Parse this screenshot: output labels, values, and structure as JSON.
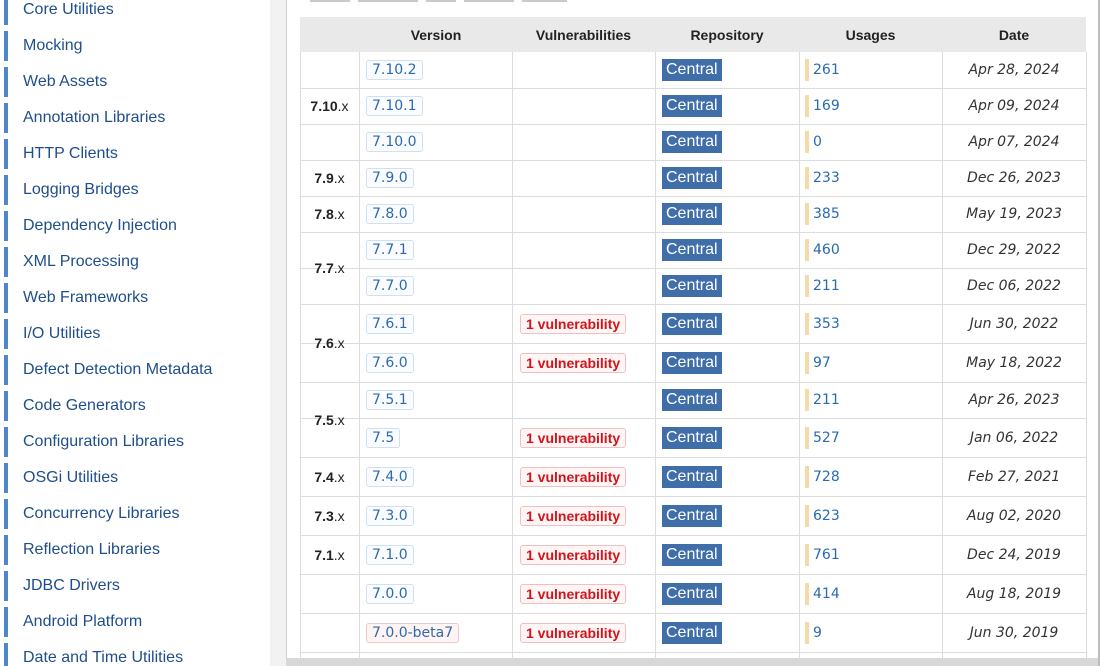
{
  "sidebar": {
    "items": [
      "Core Utilities",
      "Mocking",
      "Web Assets",
      "Annotation Libraries",
      "HTTP Clients",
      "Logging Bridges",
      "Dependency Injection",
      "XML Processing",
      "Web Frameworks",
      "I/O Utilities",
      "Defect Detection Metadata",
      "Code Generators",
      "Configuration Libraries",
      "OSGi Utilities",
      "Concurrency Libraries",
      "Reflection Libraries",
      "JDBC Drivers",
      "Android Platform",
      "Date and Time Utilities"
    ]
  },
  "table": {
    "headers": [
      "Version",
      "Vulnerabilities",
      "Repository",
      "Usages",
      "Date"
    ],
    "rows": [
      {
        "version": "7.10.2",
        "vuln": "",
        "repo": "Central",
        "usages": "261",
        "date": "Apr 28, 2024"
      },
      {
        "version": "7.10.1",
        "vuln": "",
        "repo": "Central",
        "usages": "169",
        "date": "Apr 09, 2024"
      },
      {
        "version": "7.10.0",
        "vuln": "",
        "repo": "Central",
        "usages": "0",
        "date": "Apr 07, 2024"
      },
      {
        "version": "7.9.0",
        "vuln": "",
        "repo": "Central",
        "usages": "233",
        "date": "Dec 26, 2023"
      },
      {
        "version": "7.8.0",
        "vuln": "",
        "repo": "Central",
        "usages": "385",
        "date": "May 19, 2023"
      },
      {
        "version": "7.7.1",
        "vuln": "",
        "repo": "Central",
        "usages": "460",
        "date": "Dec 29, 2022"
      },
      {
        "version": "7.7.0",
        "vuln": "",
        "repo": "Central",
        "usages": "211",
        "date": "Dec 06, 2022"
      },
      {
        "version": "7.6.1",
        "vuln": "1 vulnerability",
        "repo": "Central",
        "usages": "353",
        "date": "Jun 30, 2022"
      },
      {
        "version": "7.6.0",
        "vuln": "1 vulnerability",
        "repo": "Central",
        "usages": "97",
        "date": "May 18, 2022"
      },
      {
        "version": "7.5.1",
        "vuln": "",
        "repo": "Central",
        "usages": "211",
        "date": "Apr 26, 2023"
      },
      {
        "version": "7.5",
        "vuln": "1 vulnerability",
        "repo": "Central",
        "usages": "527",
        "date": "Jan 06, 2022"
      },
      {
        "version": "7.4.0",
        "vuln": "1 vulnerability",
        "repo": "Central",
        "usages": "728",
        "date": "Feb 27, 2021"
      },
      {
        "version": "7.3.0",
        "vuln": "1 vulnerability",
        "repo": "Central",
        "usages": "623",
        "date": "Aug 02, 2020"
      },
      {
        "version": "7.1.0",
        "vuln": "1 vulnerability",
        "repo": "Central",
        "usages": "761",
        "date": "Dec 24, 2019"
      },
      {
        "version": "7.0.0",
        "vuln": "1 vulnerability",
        "repo": "Central",
        "usages": "414",
        "date": "Aug 18, 2019"
      },
      {
        "version": "7.0.0-beta7",
        "vuln": "1 vulnerability",
        "repo": "Central",
        "usages": "9",
        "date": "Jun 30, 2019"
      }
    ],
    "groups": [
      {
        "main": "7.10",
        "suffix": ".x"
      },
      {
        "main": "7.9",
        "suffix": ".x"
      },
      {
        "main": "7.8",
        "suffix": ".x"
      },
      {
        "main": "7.7",
        "suffix": ".x"
      },
      {
        "main": "7.6",
        "suffix": ".x"
      },
      {
        "main": "7.5",
        "suffix": ".x"
      },
      {
        "main": "7.4",
        "suffix": ".x"
      },
      {
        "main": "7.3",
        "suffix": ".x"
      },
      {
        "main": "7.1",
        "suffix": ".x"
      },
      {
        "main": "",
        "suffix": ""
      }
    ]
  },
  "colors": {
    "accent": "#3f6ea8",
    "link": "#2a6ab0",
    "danger": "#d1141b",
    "usage_bar": "#f5d9a8"
  }
}
